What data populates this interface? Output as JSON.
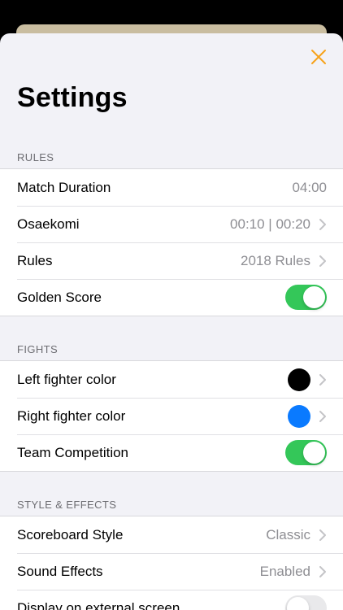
{
  "page": {
    "title": "Settings"
  },
  "icons": {
    "close": "close-icon",
    "chevron": "chevron-right-icon"
  },
  "colors": {
    "accent": "#f7a21a",
    "toggle_on": "#34c759",
    "left_fighter": "#000000",
    "right_fighter": "#0a7aff"
  },
  "sections": {
    "rules": {
      "header": "RULES",
      "match_duration": {
        "label": "Match Duration",
        "value": "04:00"
      },
      "osaekomi": {
        "label": "Osaekomi",
        "value": "00:10 | 00:20"
      },
      "rules": {
        "label": "Rules",
        "value": "2018 Rules"
      },
      "golden_score": {
        "label": "Golden Score",
        "enabled": true
      }
    },
    "fights": {
      "header": "FIGHTS",
      "left_color": {
        "label": "Left fighter color",
        "color": "#000000"
      },
      "right_color": {
        "label": "Right fighter color",
        "color": "#0a7aff"
      },
      "team_competition": {
        "label": "Team Competition",
        "enabled": true
      }
    },
    "style": {
      "header": "STYLE & EFFECTS",
      "scoreboard_style": {
        "label": "Scoreboard Style",
        "value": "Classic"
      },
      "sound_effects": {
        "label": "Sound Effects",
        "value": "Enabled"
      },
      "external_screen": {
        "label": "Display on external screen",
        "enabled": false
      }
    }
  }
}
